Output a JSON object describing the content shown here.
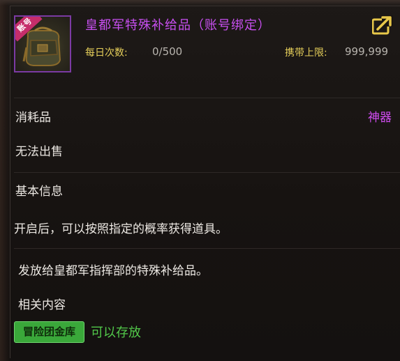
{
  "item": {
    "title": "皇都军特殊补给品（账号绑定）",
    "icon": "supply-bag-icon",
    "badge": "账号",
    "daily_label": "每日次数:",
    "daily_value": "0/500",
    "carry_label": "携带上限:",
    "carry_value": "999,999",
    "share_icon": "share-icon"
  },
  "details": {
    "category": "消耗品",
    "grade": "神器",
    "sale": "无法出售",
    "basic_info_heading": "基本信息",
    "description": "开启后，可以按照指定的概率获得道具。",
    "flavor": "发放给皇都军指挥部的特殊补给品。",
    "related_heading": "相关内容",
    "storage_badge": "冒险团金库",
    "storage_text": "可以存放"
  },
  "colors": {
    "title": "#c84ff0",
    "label_gold": "#e6cf5a",
    "grade": "#d04cf0",
    "storage_green": "#52c94a"
  }
}
